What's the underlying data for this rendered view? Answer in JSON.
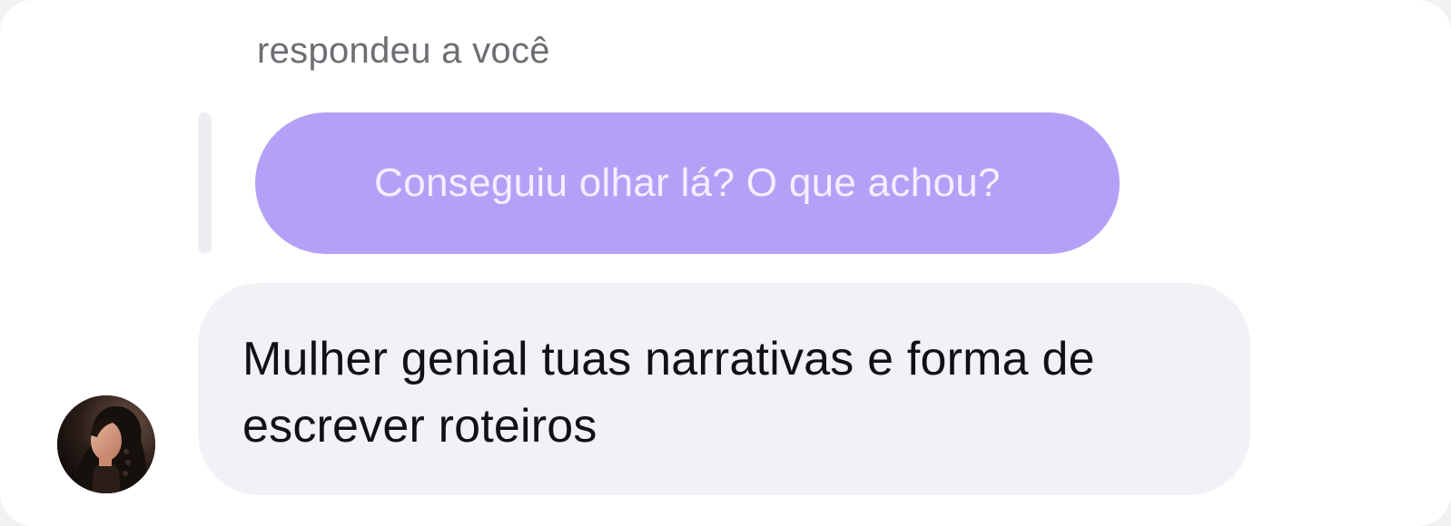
{
  "thread": {
    "reply_context": "respondeu a você",
    "quoted_message": "Conseguiu olhar lá? O que achou?",
    "message": "Mulher genial tuas narrativas e forma de escrever roteiros"
  },
  "colors": {
    "quoted_bubble": "#b4a1f7",
    "message_bubble": "#f0f2f5",
    "reply_bar": "#eceef1"
  }
}
